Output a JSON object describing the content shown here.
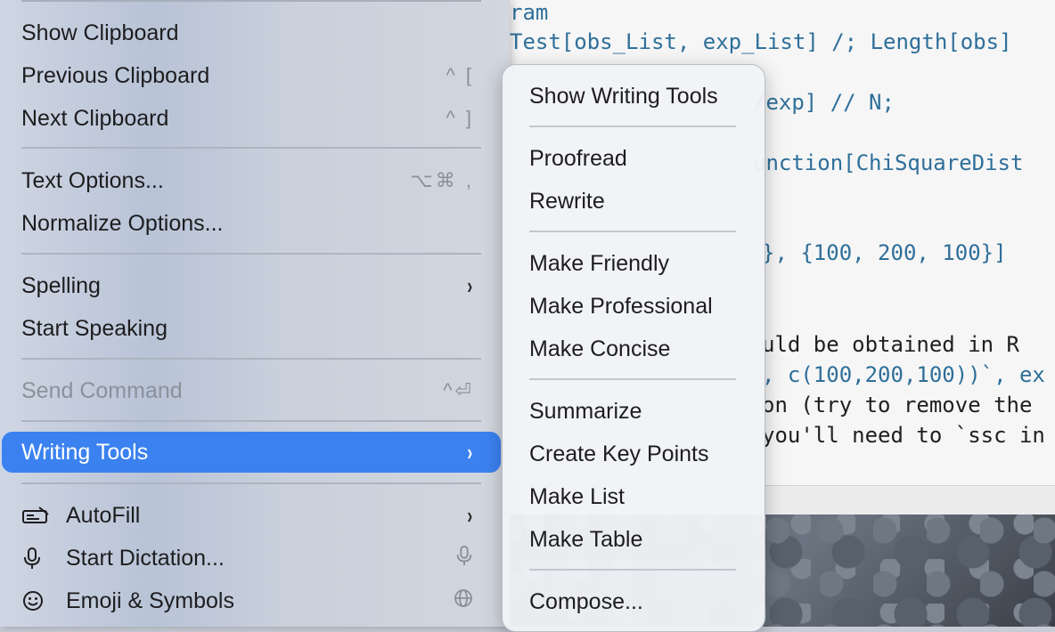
{
  "editor": {
    "lines": [
      {
        "text": "ram",
        "style": "num"
      },
      {
        "text": "Test[obs_List, exp_List] /; Length[obs]",
        "style": "num"
      },
      {
        "text": "/exp] // N;",
        "style": "num"
      },
      {
        "text": "unction[ChiSquareDist",
        "style": "num"
      },
      {
        "text": "}, {100, 200, 100}]",
        "style": "num"
      },
      {
        "text": "uld be obtained in R",
        "style": "plain"
      },
      {
        "text": ", c(100,200,100))`, ex",
        "style": "num"
      },
      {
        "text": "on (try to remove the",
        "style": "plain"
      },
      {
        "text": "you'll need to `ssc in",
        "style": "plain"
      }
    ]
  },
  "menu": {
    "show_clipboard": "Show Clipboard",
    "previous_clipboard": "Previous Clipboard",
    "previous_clipboard_sc": "^ [",
    "next_clipboard": "Next Clipboard",
    "next_clipboard_sc": "^ ]",
    "text_options": "Text Options...",
    "text_options_sc": "⌥⌘ ,",
    "normalize_options": "Normalize Options...",
    "spelling": "Spelling",
    "start_speaking": "Start Speaking",
    "send_command": "Send Command",
    "send_command_sc": "^⏎",
    "writing_tools": "Writing Tools",
    "autofill": "AutoFill",
    "start_dictation": "Start Dictation...",
    "emoji_symbols": "Emoji & Symbols",
    "chevron": "›"
  },
  "submenu": {
    "show_writing_tools": "Show Writing Tools",
    "proofread": "Proofread",
    "rewrite": "Rewrite",
    "make_friendly": "Make Friendly",
    "make_professional": "Make Professional",
    "make_concise": "Make Concise",
    "summarize": "Summarize",
    "create_key_points": "Create Key Points",
    "make_list": "Make List",
    "make_table": "Make Table",
    "compose": "Compose..."
  },
  "colors": {
    "highlight": "#3b82f0"
  },
  "icons": {
    "autofill": "autofill-keyboard-icon",
    "dictation": "microphone-icon",
    "emoji": "smiley-icon",
    "globe": "globe-icon"
  }
}
